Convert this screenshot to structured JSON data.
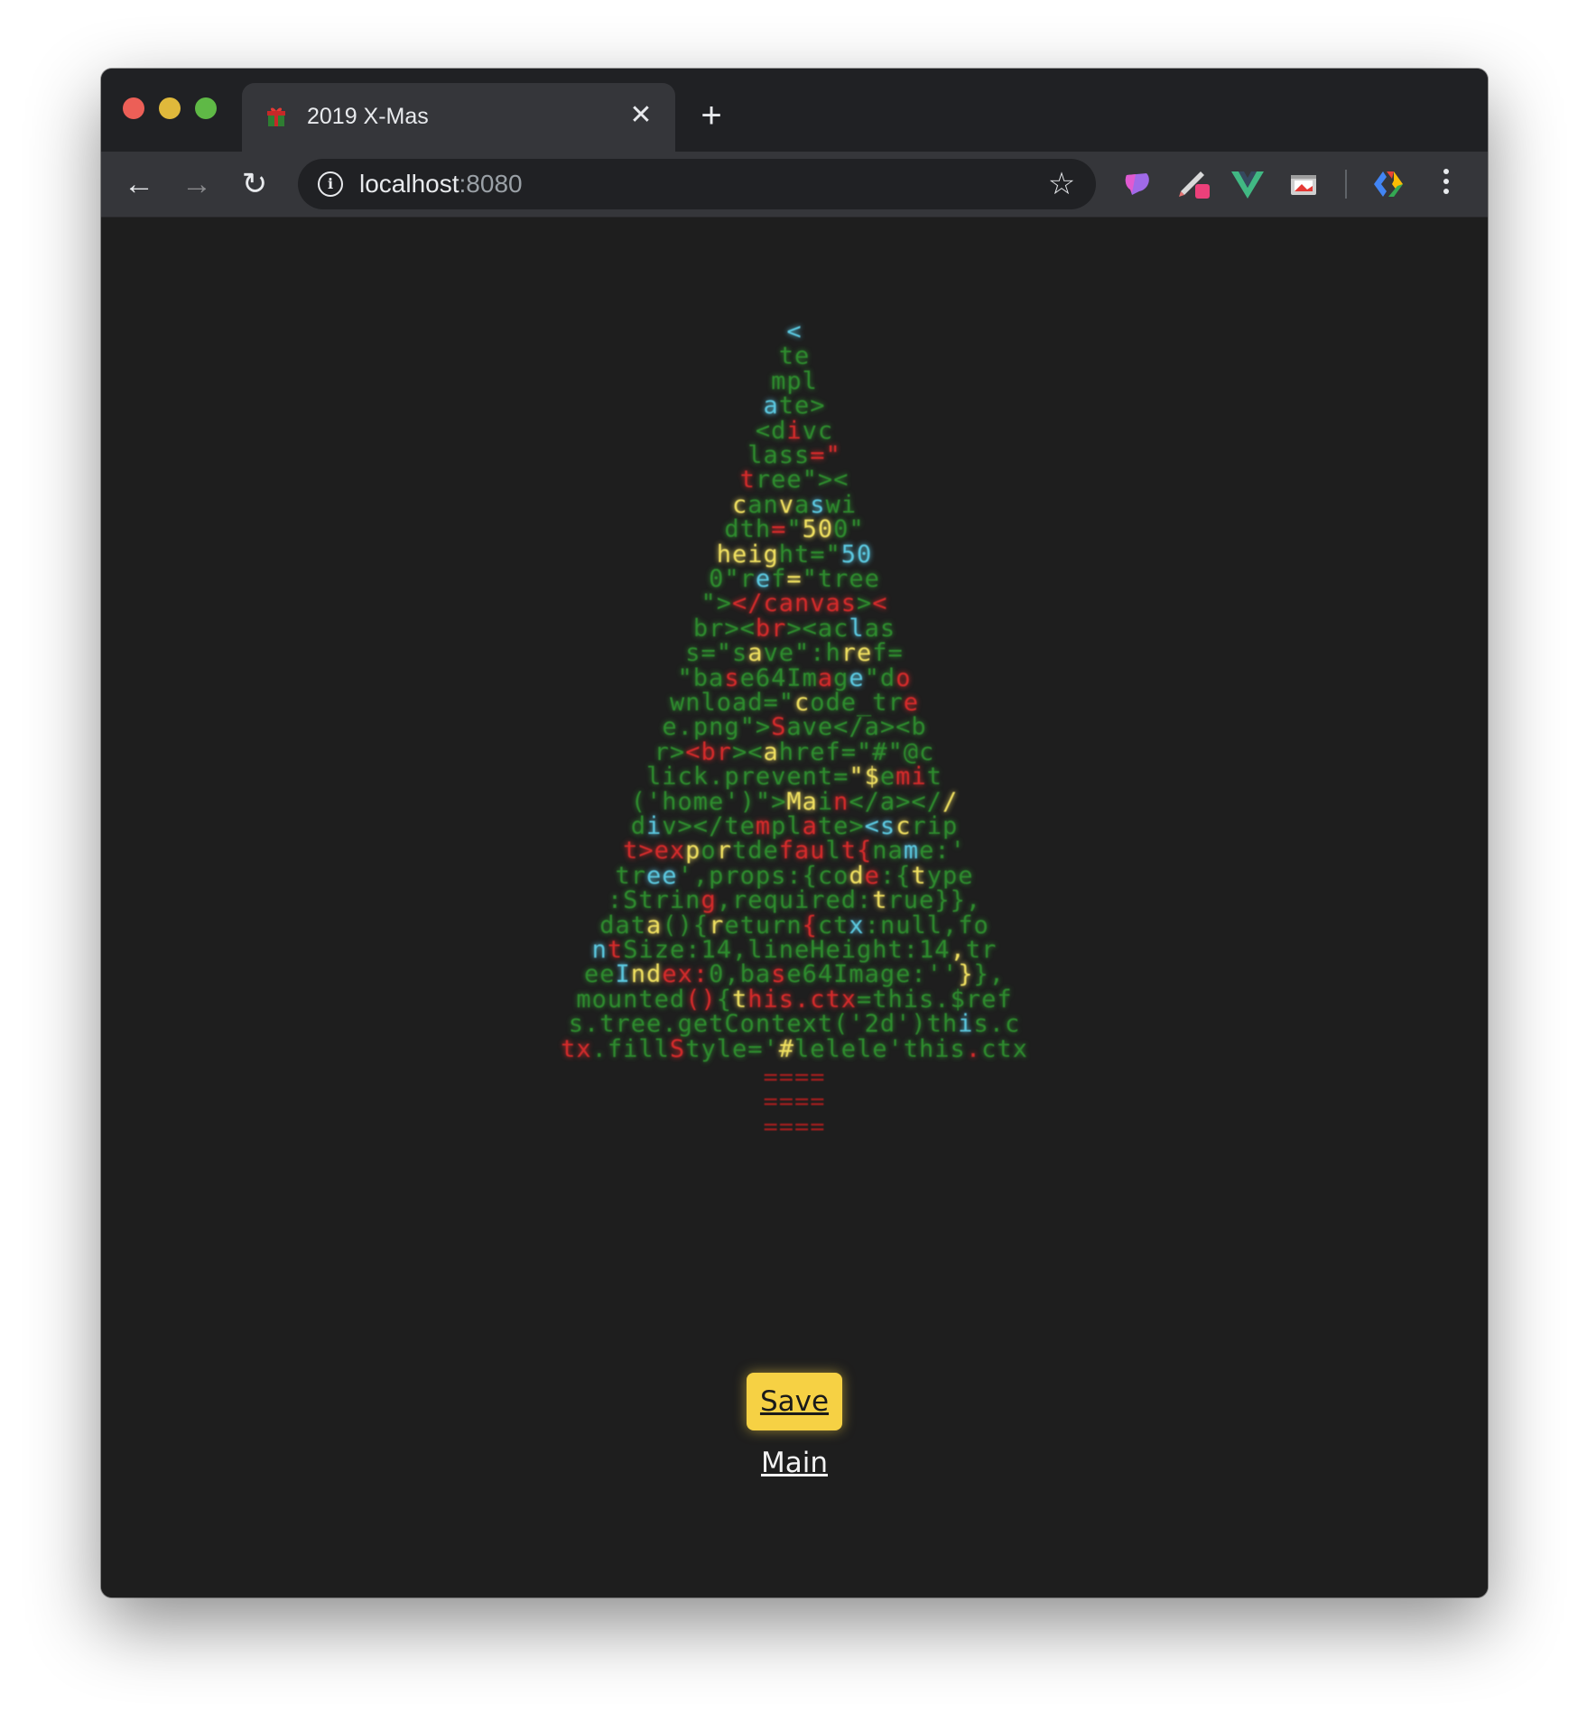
{
  "browser": {
    "tab": {
      "title": "2019 X-Mas",
      "favicon": "gift-icon",
      "close_glyph": "✕"
    },
    "new_tab_glyph": "+",
    "nav": {
      "back_glyph": "←",
      "forward_glyph": "→",
      "reload_glyph": "↻"
    },
    "address": {
      "host": "localhost",
      "port": ":8080"
    },
    "bookmark_glyph": "☆",
    "extensions": [
      "paint-extension-icon",
      "pen-extension-icon",
      "vue-devtools-icon",
      "screenshot-extension-icon",
      "google-extension-icon"
    ]
  },
  "tree": {
    "colors": {
      "g": "#2e8b2e",
      "r": "#d42b2b",
      "y": "#f0e060",
      "b": "#5bc8e0"
    },
    "rows": [
      [
        [
          "b",
          "<"
        ]
      ],
      [
        [
          "g",
          "te"
        ]
      ],
      [
        [
          "g",
          "mpl"
        ]
      ],
      [
        [
          "b",
          "a"
        ],
        [
          "g",
          "te>"
        ]
      ],
      [
        [
          "g",
          "<d"
        ],
        [
          "r",
          "i"
        ],
        [
          "g",
          "vc"
        ]
      ],
      [
        [
          "g",
          "lass"
        ],
        [
          "r",
          "=\""
        ]
      ],
      [
        [
          "r",
          "t"
        ],
        [
          "g",
          "ree\"><"
        ]
      ],
      [
        [
          "y",
          "c"
        ],
        [
          "g",
          "an"
        ],
        [
          "y",
          "v"
        ],
        [
          "g",
          "a"
        ],
        [
          "b",
          "s"
        ],
        [
          "g",
          "wi"
        ]
      ],
      [
        [
          "g",
          "dth"
        ],
        [
          "r",
          "="
        ],
        [
          "g",
          "\""
        ],
        [
          "y",
          "50"
        ],
        [
          "g",
          "0\""
        ]
      ],
      [
        [
          "y",
          "heig"
        ],
        [
          "g",
          "ht=\""
        ],
        [
          "b",
          "50"
        ]
      ],
      [
        [
          "g",
          "0\"r"
        ],
        [
          "b",
          "e"
        ],
        [
          "g",
          "f"
        ],
        [
          "y",
          "="
        ],
        [
          "g",
          "\"tree"
        ]
      ],
      [
        [
          "g",
          "\">"
        ],
        [
          "r",
          "</canvas"
        ],
        [
          "g",
          ">"
        ],
        [
          "r",
          "<"
        ]
      ],
      [
        [
          "g",
          "br><"
        ],
        [
          "r",
          "br"
        ],
        [
          "g",
          "><ac"
        ],
        [
          "b",
          "l"
        ],
        [
          "g",
          "as"
        ]
      ],
      [
        [
          "g",
          "s=\"s"
        ],
        [
          "y",
          "a"
        ],
        [
          "g",
          "ve\":h"
        ],
        [
          "y",
          "re"
        ],
        [
          "g",
          "f="
        ]
      ],
      [
        [
          "g",
          "\"ba"
        ],
        [
          "r",
          "s"
        ],
        [
          "g",
          "e64Im"
        ],
        [
          "r",
          "a"
        ],
        [
          "g",
          "g"
        ],
        [
          "b",
          "e"
        ],
        [
          "g",
          "\"d"
        ],
        [
          "r",
          "o"
        ]
      ],
      [
        [
          "g",
          "wnload=\""
        ],
        [
          "y",
          "c"
        ],
        [
          "g",
          "ode_tr"
        ],
        [
          "r",
          "e"
        ]
      ],
      [
        [
          "g",
          "e.png\">"
        ],
        [
          "r",
          "S"
        ],
        [
          "g",
          "ave</a><b"
        ]
      ],
      [
        [
          "g",
          "r>"
        ],
        [
          "r",
          "<br"
        ],
        [
          "g",
          "><"
        ],
        [
          "y",
          "a"
        ],
        [
          "g",
          "href=\"#\"@c"
        ]
      ],
      [
        [
          "g",
          "lick.prevent="
        ],
        [
          "y",
          "\"$"
        ],
        [
          "g",
          "e"
        ],
        [
          "r",
          "mi"
        ],
        [
          "g",
          "t"
        ]
      ],
      [
        [
          "g",
          "('home')\">"
        ],
        [
          "y",
          "Ma"
        ],
        [
          "g",
          "i"
        ],
        [
          "r",
          "n"
        ],
        [
          "g",
          "</a></"
        ],
        [
          "y",
          "/"
        ]
      ],
      [
        [
          "g",
          "d"
        ],
        [
          "b",
          "i"
        ],
        [
          "g",
          "v></te"
        ],
        [
          "r",
          "m"
        ],
        [
          "g",
          "pl"
        ],
        [
          "r",
          "a"
        ],
        [
          "g",
          "te>"
        ],
        [
          "b",
          "<s"
        ],
        [
          "y",
          "c"
        ],
        [
          "g",
          "rip"
        ]
      ],
      [
        [
          "r",
          "t>ex"
        ],
        [
          "y",
          "p"
        ],
        [
          "g",
          "o"
        ],
        [
          "y",
          "r"
        ],
        [
          "g",
          "tde"
        ],
        [
          "r",
          "fau"
        ],
        [
          "g",
          "l"
        ],
        [
          "r",
          "t{"
        ],
        [
          "g",
          "na"
        ],
        [
          "b",
          "m"
        ],
        [
          "g",
          "e:'"
        ]
      ],
      [
        [
          "g",
          "tr"
        ],
        [
          "b",
          "ee"
        ],
        [
          "g",
          "',props:{co"
        ],
        [
          "y",
          "d"
        ],
        [
          "r",
          "e"
        ],
        [
          "g",
          ":{"
        ],
        [
          "y",
          "t"
        ],
        [
          "g",
          "ype"
        ]
      ],
      [
        [
          "g",
          ":Strin"
        ],
        [
          "r",
          "g"
        ],
        [
          "g",
          ",required:"
        ],
        [
          "y",
          "t"
        ],
        [
          "g",
          "rue}},"
        ]
      ],
      [
        [
          "g",
          "dat"
        ],
        [
          "y",
          "a"
        ],
        [
          "g",
          "(){"
        ],
        [
          "y",
          "r"
        ],
        [
          "g",
          "eturn"
        ],
        [
          "r",
          "{"
        ],
        [
          "g",
          "ct"
        ],
        [
          "b",
          "x"
        ],
        [
          "g",
          ":null,fo"
        ]
      ],
      [
        [
          "b",
          "n"
        ],
        [
          "r",
          "t"
        ],
        [
          "g",
          "Size:14,lineHeight:14"
        ],
        [
          "y",
          ","
        ],
        [
          "g",
          "tr"
        ]
      ],
      [
        [
          "g",
          "ee"
        ],
        [
          "b",
          "I"
        ],
        [
          "y",
          "nd"
        ],
        [
          "r",
          "ex:"
        ],
        [
          "g",
          "0,ba"
        ],
        [
          "r",
          "s"
        ],
        [
          "g",
          "e64Image:''"
        ],
        [
          "y",
          "}"
        ],
        [
          "g",
          "},"
        ]
      ],
      [
        [
          "g",
          "mounted"
        ],
        [
          "r",
          "()"
        ],
        [
          "g",
          "{"
        ],
        [
          "y",
          "t"
        ],
        [
          "r",
          "his.ctx"
        ],
        [
          "g",
          "=this.$ref"
        ]
      ],
      [
        [
          "g",
          "s.tree.getContext('2d')th"
        ],
        [
          "b",
          "i"
        ],
        [
          "g",
          "s.c"
        ]
      ],
      [
        [
          "r",
          "tx"
        ],
        [
          "g",
          ".fill"
        ],
        [
          "r",
          "S"
        ],
        [
          "g",
          "tyle='"
        ],
        [
          "y",
          "#"
        ],
        [
          "g",
          "lelele'this"
        ],
        [
          "r",
          "."
        ],
        [
          "g",
          "ctx"
        ]
      ]
    ],
    "trunk": [
      "====",
      "====",
      "===="
    ]
  },
  "actions": {
    "save_label": "Save",
    "main_label": "Main"
  }
}
